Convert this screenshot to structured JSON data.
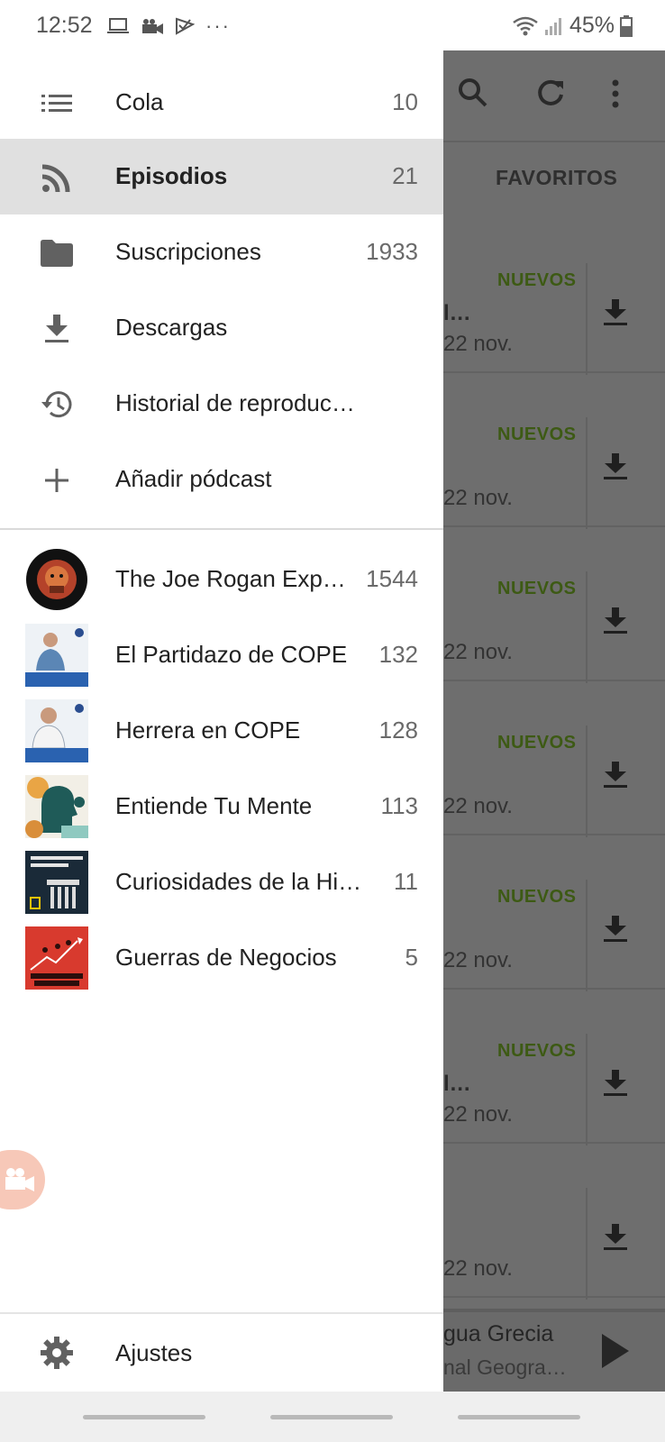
{
  "status_bar": {
    "time": "12:52",
    "battery": "45%"
  },
  "drawer": {
    "nav_items": [
      {
        "label": "Cola",
        "count": "10",
        "icon": "queue-list-icon"
      },
      {
        "label": "Episodios",
        "count": "21",
        "icon": "rss-feed-icon"
      },
      {
        "label": "Suscripciones",
        "count": "1933",
        "icon": "folder-icon"
      },
      {
        "label": "Descargas",
        "count": "",
        "icon": "download-icon"
      },
      {
        "label": "Historial de reproduc…",
        "count": "",
        "icon": "history-icon"
      },
      {
        "label": "Añadir pódcast",
        "count": "",
        "icon": "add-icon"
      }
    ],
    "podcasts": [
      {
        "label": "The Joe Rogan Exp…",
        "count": "1544",
        "art_text": "THE JOE ROGAN EXPERIENCE"
      },
      {
        "label": "El Partidazo de COPE",
        "count": "132",
        "art_text": "El Partidazo de COPE"
      },
      {
        "label": "Herrera en COPE",
        "count": "128",
        "art_text": "Herrera en COPE"
      },
      {
        "label": "Entiende Tu Mente",
        "count": "113",
        "art_text": ""
      },
      {
        "label": "Curiosidades de la Hi…",
        "count": "11",
        "art_text": "Curiosidades de la Historia"
      },
      {
        "label": "Guerras de Negocios",
        "count": "5",
        "art_text": "GUERRAS DE NEGOCIOS"
      }
    ],
    "settings_label": "Ajustes"
  },
  "background": {
    "tab_label": "FAVORITOS",
    "rows": [
      {
        "badge": "NUEVOS",
        "title": "l…",
        "date": "22 nov."
      },
      {
        "badge": "NUEVOS",
        "title": "",
        "date": "22 nov."
      },
      {
        "badge": "NUEVOS",
        "title": "",
        "date": "22 nov."
      },
      {
        "badge": "NUEVOS",
        "title": "",
        "date": "22 nov."
      },
      {
        "badge": "NUEVOS",
        "title": "",
        "date": "22 nov."
      },
      {
        "badge": "NUEVOS",
        "title": "l…",
        "date": "22 nov."
      },
      {
        "badge": "",
        "title": "",
        "date": "22 nov."
      }
    ],
    "player": {
      "title": "gua Grecia",
      "subtitle": "nal Geogra…"
    }
  }
}
